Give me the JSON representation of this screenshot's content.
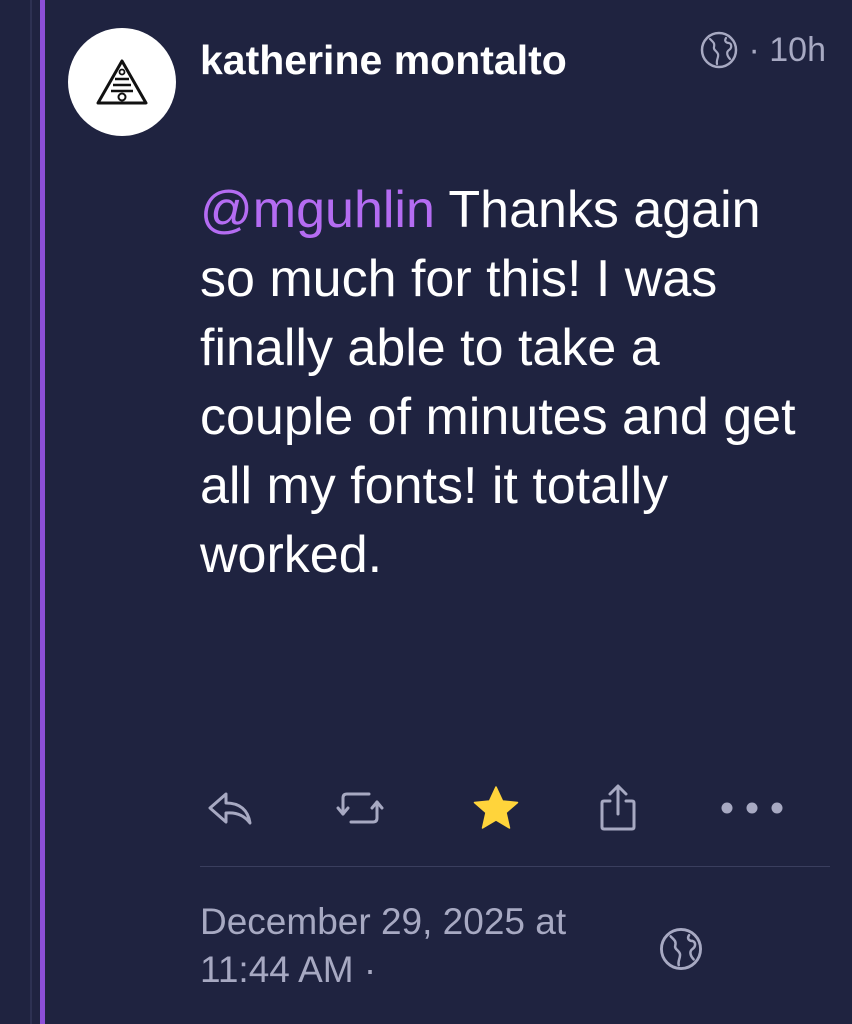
{
  "post": {
    "author_name": "katherine montalto",
    "time_ago": "· 10h",
    "mention": "@mguhlin",
    "body": " Thanks again so much for this! I was finally able to take a couple of minutes and get all my fonts! it totally worked.",
    "full_date": "December 29, 2025 at 11:44 AM  ·",
    "visibility_icon": "globe-icon",
    "favorited": true
  },
  "actions": [
    {
      "name": "reply",
      "icon": "reply-icon"
    },
    {
      "name": "boost",
      "icon": "boost-icon"
    },
    {
      "name": "favorite",
      "icon": "star-icon"
    },
    {
      "name": "share",
      "icon": "share-icon"
    },
    {
      "name": "more",
      "icon": "more-icon"
    }
  ],
  "colors": {
    "background": "#1f2340",
    "accent": "#8c4fd8",
    "mention": "#b46cf2",
    "favorite": "#ffd43b",
    "muted": "#a7a9c2"
  }
}
